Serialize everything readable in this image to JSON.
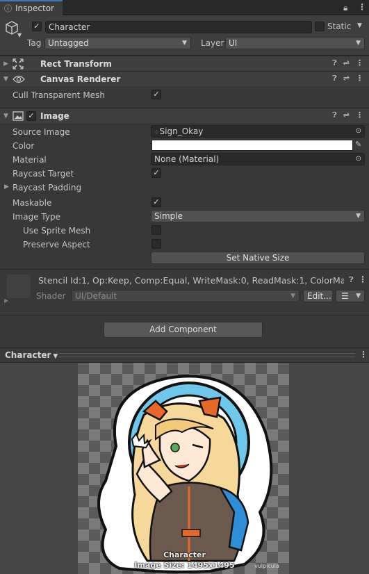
{
  "tab": {
    "label": "Inspector"
  },
  "gameobject": {
    "name": "Character",
    "static_label": "Static",
    "tag_label": "Tag",
    "tag_value": "Untagged",
    "layer_label": "Layer",
    "layer_value": "UI"
  },
  "components": {
    "rect_transform": {
      "title": "Rect Transform"
    },
    "canvas_renderer": {
      "title": "Canvas Renderer",
      "cull_label": "Cull Transparent Mesh",
      "cull_checked": true
    },
    "image": {
      "title": "Image",
      "source_image_label": "Source Image",
      "source_image_value": "Sign_Okay",
      "color_label": "Color",
      "color_value": "#ffffff",
      "material_label": "Material",
      "material_value": "None (Material)",
      "raycast_target_label": "Raycast Target",
      "raycast_padding_label": "Raycast Padding",
      "maskable_label": "Maskable",
      "image_type_label": "Image Type",
      "image_type_value": "Simple",
      "use_sprite_mesh_label": "Use Sprite Mesh",
      "preserve_aspect_label": "Preserve Aspect",
      "set_native_size_label": "Set Native Size"
    },
    "material": {
      "stencil_text": "Stencil Id:1, Op:Keep, Comp:Equal, WriteMask:0, ReadMask:1, ColorMa",
      "shader_label": "Shader",
      "shader_value": "UI/Default",
      "edit_label": "Edit..."
    }
  },
  "add_component_label": "Add Component",
  "preview": {
    "title": "Character",
    "caption_name": "Character",
    "caption_size": "Image Size: 1495x1495",
    "watermark": "vulpicula"
  },
  "colors": {
    "accent": "#3a79bb",
    "halo": "#6fc8ec",
    "hair": "#f6d89a",
    "jacket": "#2f8fd6",
    "bow": "#e8682a"
  }
}
